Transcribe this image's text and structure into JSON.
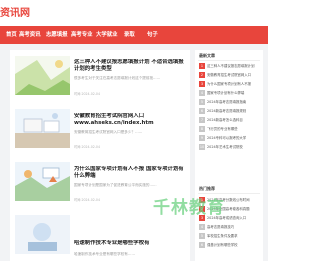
{
  "site": {
    "logo_text": "资讯网"
  },
  "nav": {
    "items": [
      "首页",
      "高考资讯",
      "志愿填报",
      "高考专业",
      "大学就业",
      "录取",
      "句子"
    ]
  },
  "articles": [
    {
      "title": "这三种人不建议报志愿填报计划 不适合选填报计划的考生类型",
      "excerpt": "很多考生对于关注在高考志愿填报计划这个提前批……",
      "date": "时间:2024-02-04"
    },
    {
      "title": "安徽教育招生考试院官网入口 www.ahseks.cn/index.htm",
      "excerpt": "安徽教育招生考试院官网入口是多少？……",
      "date": "时间:2024-02-04"
    },
    {
      "title": "为什么国家专项计划有人不报 国家专项计划有什么弊端",
      "excerpt": "国家专项计划是国家为了促进教育公平而实施的……",
      "date": "时间:2024-02-04"
    },
    {
      "title": "哈速制作技术专业是哪些学校有",
      "excerpt": "哈速制作技术专业是有哪些学校有……",
      "date": ""
    }
  ],
  "sidebar": {
    "recommend_title": "最新文章",
    "recommend": [
      "这三种人不建议报志愿填报计划",
      "安徽教育招生考试院官网入口",
      "为什么国家专项计划有人不报",
      "国家专项计划有什么弊端",
      "2024年高考志愿填报指南",
      "2024新高考志愿填报规则",
      "2024新高考怎么选科目",
      "飞行员的专业有哪些",
      "2024专科可以报考的大学",
      "2024年艺术生考试院校"
    ],
    "hot_title": "热门推荐",
    "hot": [
      "2024年高考分数线公布时间",
      "2024年全国高考卷各科真题",
      "2024年高考成绩查询入口",
      "高考志愿填报技巧",
      "军校招生条件及要求",
      "强基计划有哪些学校"
    ]
  },
  "watermark": {
    "text": "千林教育"
  },
  "colors": {
    "brand_red": "#e8453c",
    "watermark_green": "#6ed282"
  }
}
